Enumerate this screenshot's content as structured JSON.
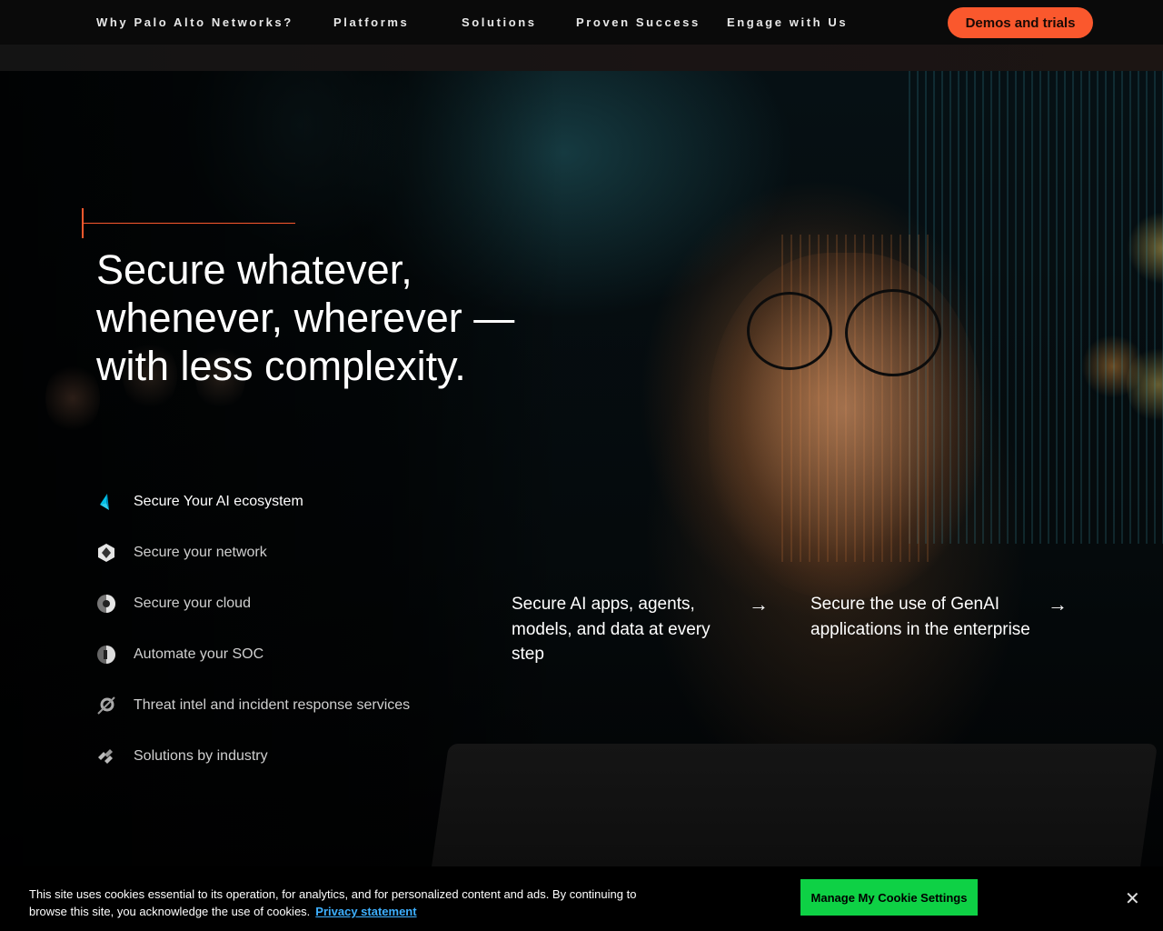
{
  "nav": {
    "items": [
      {
        "label": "Why Palo Alto Networks?"
      },
      {
        "label": "Platforms"
      },
      {
        "label": "Solutions"
      },
      {
        "label": "Proven Success"
      },
      {
        "label": "Engage with Us"
      }
    ],
    "cta_label": "Demos and trials",
    "accent_color": "#fa582d"
  },
  "hero": {
    "headline": "Secure whatever, whenever, wherever — with less complexity.",
    "solutions": [
      {
        "label": "Secure Your AI ecosystem",
        "icon": "ai-prism-icon",
        "active": true
      },
      {
        "label": "Secure your network",
        "icon": "network-shield-icon",
        "active": false
      },
      {
        "label": "Secure your cloud",
        "icon": "cloud-shield-icon",
        "active": false
      },
      {
        "label": "Automate your SOC",
        "icon": "soc-shield-icon",
        "active": false
      },
      {
        "label": "Threat intel and incident response services",
        "icon": "unit42-icon",
        "active": false
      },
      {
        "label": "Solutions by industry",
        "icon": "industry-stripes-icon",
        "active": false
      }
    ],
    "features": [
      {
        "text": "Secure AI apps, agents, models, and data at every step",
        "icon": "arrow-right-icon"
      },
      {
        "text": "Secure the use of GenAI applications in the enterprise",
        "icon": "arrow-right-icon"
      }
    ]
  },
  "cookie": {
    "text": "This site uses cookies essential to its operation, for analytics, and for personalized content and ads. By continuing to browse this site, you acknowledge the use of cookies.",
    "link_label": "Privacy statement",
    "button_label": "Manage My Cookie Settings",
    "close_icon": "close-icon",
    "button_color": "#0ed145"
  }
}
